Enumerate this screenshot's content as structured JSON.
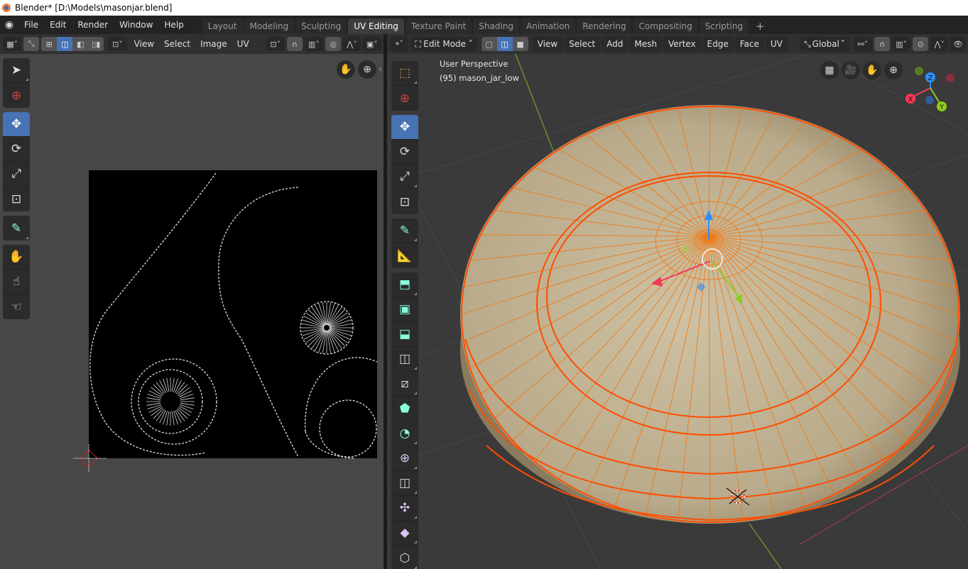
{
  "window": {
    "title": "Blender* [D:\\Models\\masonjar.blend]"
  },
  "menubar": {
    "items": [
      "File",
      "Edit",
      "Render",
      "Window",
      "Help"
    ]
  },
  "workspaces": {
    "tabs": [
      "Layout",
      "Modeling",
      "Sculpting",
      "UV Editing",
      "Texture Paint",
      "Shading",
      "Animation",
      "Rendering",
      "Compositing",
      "Scripting"
    ],
    "active": "UV Editing",
    "add_label": "+"
  },
  "uv_editor": {
    "header": {
      "menus": [
        "View",
        "Select",
        "Image",
        "UV"
      ],
      "sync_selection": "off",
      "select_mode_active": "edge"
    },
    "toolbar": [
      "select-tweak",
      "cursor",
      "move",
      "rotate",
      "scale",
      "transform",
      "annotate",
      "grab",
      "relax",
      "pinch"
    ],
    "active_tool": "move",
    "nav": [
      "hand-icon",
      "zoom-icon"
    ]
  },
  "viewport": {
    "header": {
      "mode": "Edit Mode",
      "menus": [
        "View",
        "Select",
        "Add",
        "Mesh",
        "Vertex",
        "Edge",
        "Face",
        "UV"
      ],
      "select_mode_active": "edge",
      "transform_orientation": "Global"
    },
    "overlay": {
      "view_name": "User Perspective",
      "object_label": "(95) mason_jar_low"
    },
    "gizmo": {
      "x": "X",
      "y": "Y",
      "z": "Z",
      "colors": {
        "x": "#f5385a",
        "y": "#8bcc1d",
        "z": "#2c8fff"
      }
    },
    "toolbar": [
      "select-box",
      "cursor",
      "move",
      "rotate",
      "scale",
      "transform",
      "annotate",
      "measure",
      "extrude",
      "inset",
      "bevel",
      "loop-cut",
      "knife",
      "poly-build",
      "spin",
      "smooth",
      "edge-slide",
      "shrink-fatten",
      "shear",
      "rip"
    ],
    "active_tool": "move",
    "colors": {
      "mesh": "#c8b99a",
      "wire": "#f07a16",
      "selected_edge": "#ff4d00"
    }
  }
}
